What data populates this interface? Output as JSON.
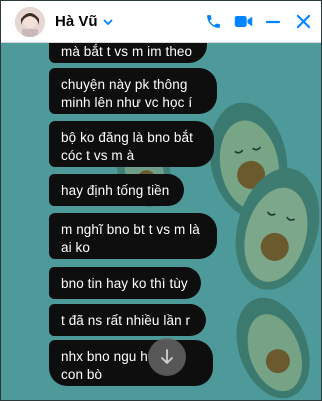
{
  "header": {
    "contact_name": "Hà Vũ",
    "icons": [
      "chevron-down-icon",
      "phone-icon",
      "video-icon",
      "minimize-icon",
      "close-icon"
    ]
  },
  "colors": {
    "accent": "#0084ff",
    "bubble": "#0e0e0e",
    "background": "#4e9a9b"
  },
  "messages": [
    "mà bắt t vs m im theo",
    "chuyện này pk thông minh lên như vc học í",
    "bộ  ko đăng là bno bắt cóc t vs m à",
    "hay định tống tiền",
    "m nghĩ bno bt t vs m là ai ko",
    "bno tin hay ko thì tùy",
    "t đã ns rất nhiều lần r",
    "nhx bno ngu h... con bò"
  ],
  "messages_display": {
    "m0": "mà bắt t vs m im theo",
    "m1a": "chuyện này pk thông",
    "m1b": "minh lên như vc học í",
    "m2a": "bộ  ko đăng là bno bắt",
    "m2b": "cóc t vs m à",
    "m3": "hay định tống tiền",
    "m4a": "m nghĩ bno bt t vs m là",
    "m4b": "ai ko",
    "m5": "bno tin hay ko thì tùy",
    "m6": "t đã ns rất nhiều lần r",
    "m7a": "nhx bno ngu h",
    "m7b": "con bò"
  }
}
